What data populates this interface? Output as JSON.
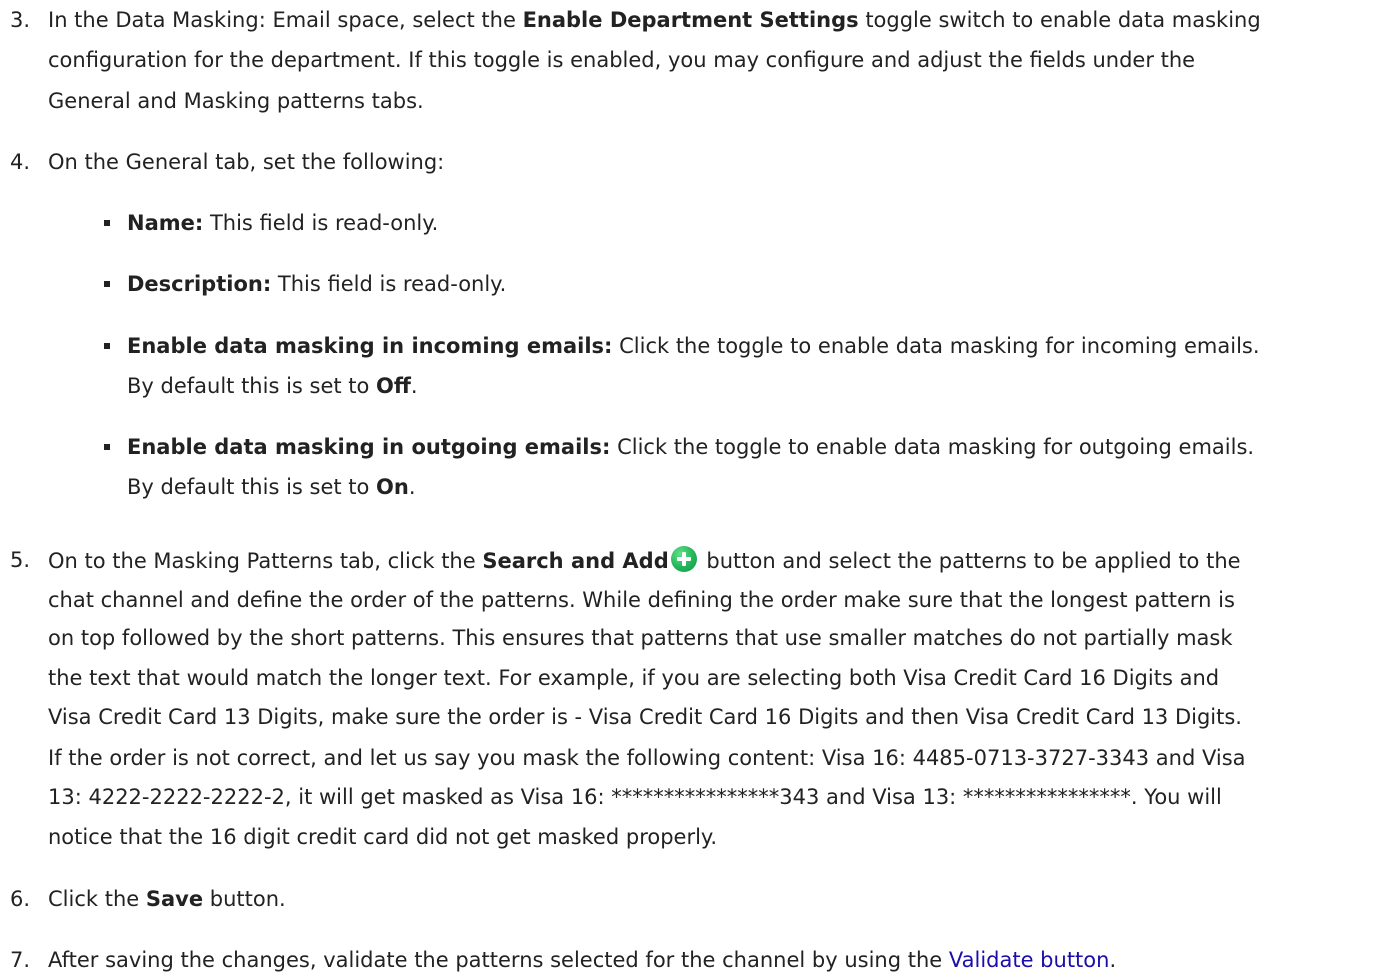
{
  "steps": {
    "s3": {
      "num": "3.",
      "l1a": "In the Data Masking: Email space, select the ",
      "l1b": "Enable Department Settings",
      "l1c": " toggle switch to enable data masking",
      "l2": "configuration for the department. If this toggle is enabled, you may configure and adjust the fields under the",
      "l3": "General and Masking patterns tabs."
    },
    "s4": {
      "num": "4.",
      "l1": "On the General tab, set the following:",
      "bullets": [
        {
          "label": "Name:",
          "text": " This field is read-only."
        },
        {
          "label": "Description:",
          "text": "  This field is read-only."
        },
        {
          "label": "Enable data masking in incoming emails:",
          "text": " Click the toggle to enable data masking for incoming emails.",
          "l2a": "By default this is set to ",
          "l2b": "Off",
          "l2c": "."
        },
        {
          "label": "Enable data masking in outgoing emails:",
          "text": " Click the toggle to enable data masking for outgoing emails.",
          "l2a": "By default this is set to ",
          "l2b": "On",
          "l2c": "."
        }
      ]
    },
    "s5": {
      "num": "5.",
      "l1a": "On to the Masking Patterns tab, click the ",
      "l1b": "Search and Add",
      "l1c": " button and select the patterns to be applied to the",
      "l2": "chat channel and define the order of the patterns. While defining the order make sure that the longest pattern is",
      "l3": "on top followed by the short patterns. This ensures that patterns that use smaller matches do not partially mask",
      "l4": "the text that would match the longer text. For example, if you are selecting both Visa Credit Card 16 Digits and",
      "l5": "Visa Credit Card 13 Digits, make sure the order is - Visa Credit Card 16 Digits and then Visa Credit Card 13 Digits.",
      "l6": "If the order is not correct, and let us say you mask the following content: Visa 16: 4485-0713-3727-3343 and Visa",
      "l7": "13: 4222-2222-2222-2, it will get masked as Visa 16: ****************343 and Visa 13: ****************. You will",
      "l8": "notice that the 16 digit credit card did not get masked properly."
    },
    "s6": {
      "num": "6.",
      "l1a": "Click the ",
      "l1b": "Save",
      "l1c": "  button."
    },
    "s7": {
      "num": "7.",
      "l1a": "After saving the changes, validate the patterns selected for the channel by using the ",
      "l1b": "Validate button",
      "l1c": "."
    }
  },
  "icons": {
    "add": "plus-circle-icon",
    "add_color": "#22b45a",
    "link_color": "#1a0dab"
  }
}
